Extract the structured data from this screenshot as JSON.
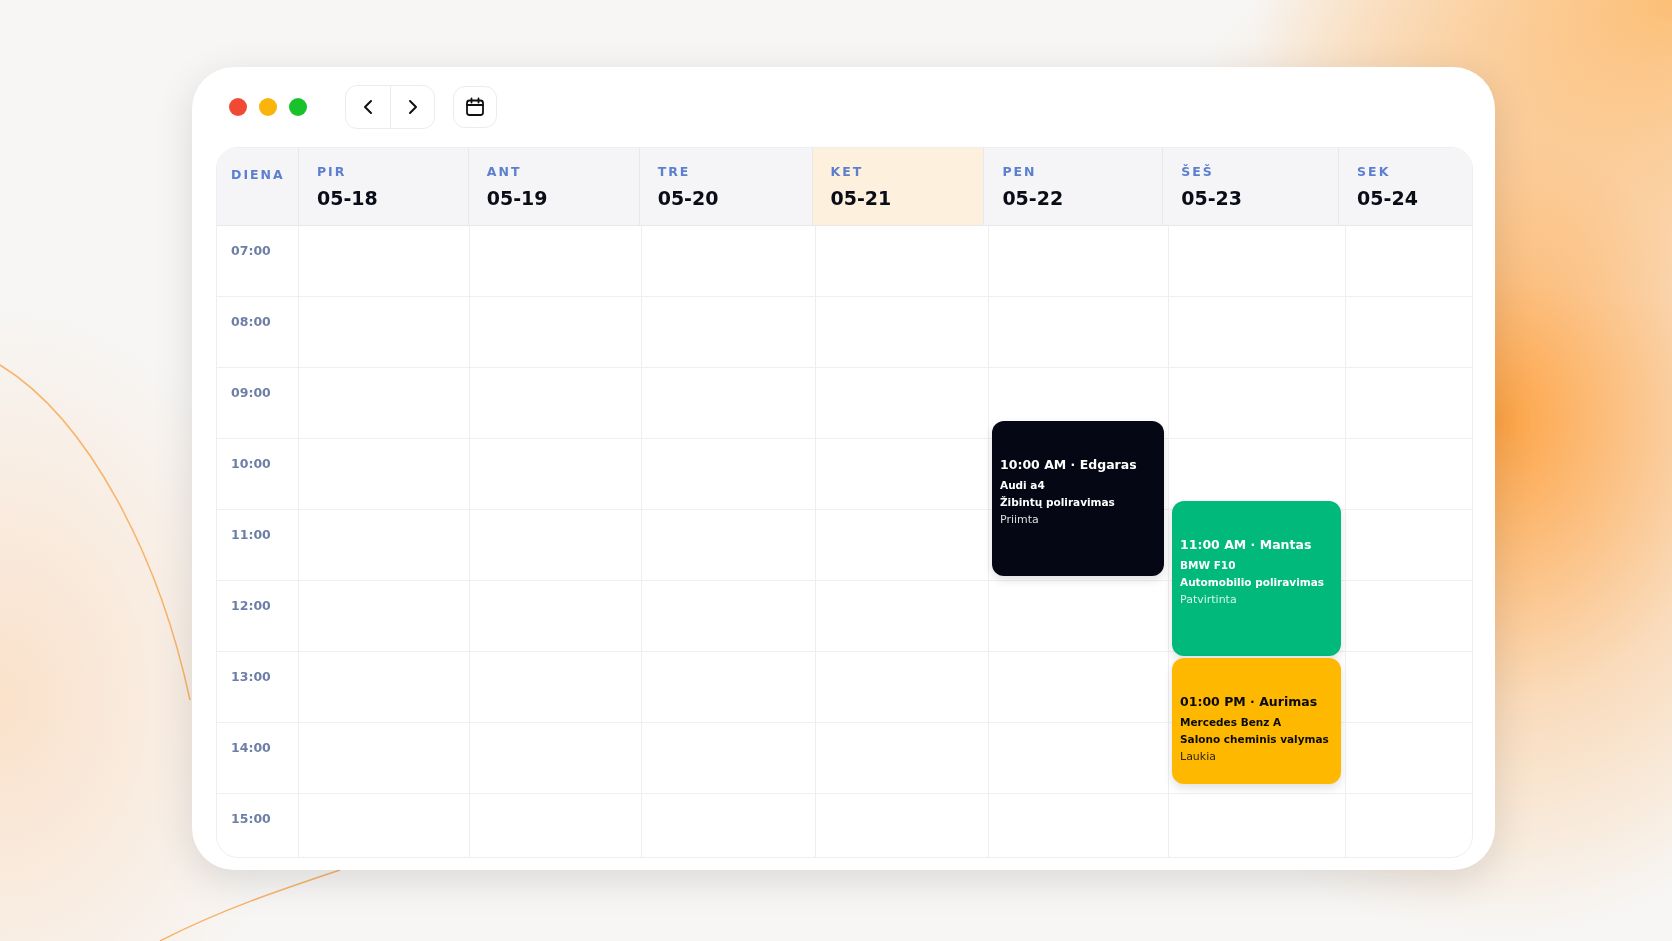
{
  "window_controls": [
    {
      "color": "#f04a35"
    },
    {
      "color": "#fbb40a"
    },
    {
      "color": "#19c22a"
    }
  ],
  "header_label": "DIENA",
  "days": [
    {
      "weekday": "PIR",
      "date": "05-18",
      "today": false
    },
    {
      "weekday": "ANT",
      "date": "05-19",
      "today": false
    },
    {
      "weekday": "TRE",
      "date": "05-20",
      "today": false
    },
    {
      "weekday": "KET",
      "date": "05-21",
      "today": true
    },
    {
      "weekday": "PEN",
      "date": "05-22",
      "today": false,
      "events": [
        {
          "title": "10:00 AM · Edgaras",
          "car": "Audi a4",
          "service": "Žibintų poliravimas",
          "status": "Priimta",
          "color": "#050714"
        }
      ]
    },
    {
      "weekday": "ŠEŠ",
      "date": "05-23",
      "today": false,
      "events": [
        {
          "title": "11:00 AM · Mantas",
          "car": "BMW F10",
          "service": "Automobilio poliravimas",
          "status": "Patvirtinta",
          "color": "#00b97a"
        },
        {
          "title": "01:00 PM · Aurimas",
          "car": "Mercedes Benz A",
          "service": "Salono cheminis valymas",
          "status": "Laukia",
          "color": "#ffb800"
        }
      ]
    },
    {
      "weekday": "SEK",
      "date": "05-24",
      "today": false
    }
  ],
  "hours": [
    "07:00",
    "08:00",
    "09:00",
    "10:00",
    "11:00",
    "12:00",
    "13:00",
    "14:00",
    "15:00"
  ]
}
